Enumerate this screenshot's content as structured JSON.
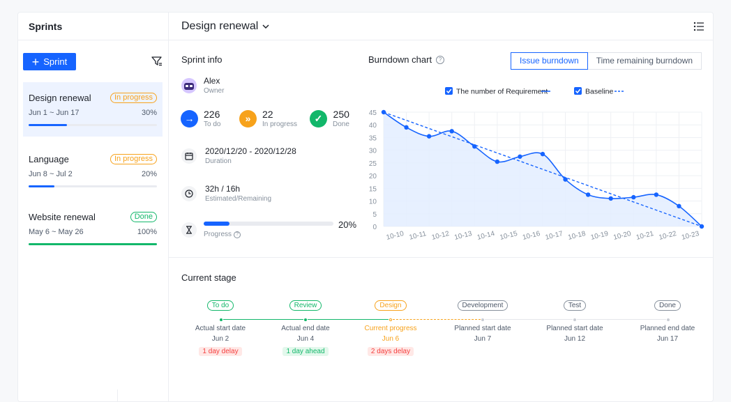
{
  "sidebar": {
    "title": "Sprints",
    "add_label": "Sprint",
    "items": [
      {
        "name": "Design renewal",
        "status": "In progress",
        "dates": "Jun 1 ~ Jun 17",
        "percent_label": "30%",
        "progress": 0.3
      },
      {
        "name": "Language",
        "status": "In progress",
        "dates": "Jun 8 ~ Jul 2",
        "percent_label": "20%",
        "progress": 0.2
      },
      {
        "name": "Website renewal",
        "status": "Done",
        "dates": "May 6 ~ May 26",
        "percent_label": "100%",
        "progress": 1.0
      }
    ]
  },
  "header": {
    "title": "Design renewal"
  },
  "info": {
    "title": "Sprint info",
    "owner_name": "Alex",
    "owner_label": "Owner",
    "stats": [
      {
        "value": "226",
        "label": "To do"
      },
      {
        "value": "22",
        "label": "In progress"
      },
      {
        "value": "250",
        "label": "Done"
      }
    ],
    "duration_value": "2020/12/20 - 2020/12/28",
    "duration_label": "Duration",
    "estimate_value": "32h / 16h",
    "estimate_label": "Estimated/Remaining",
    "progress_label": "Progress",
    "progress_pct": "20%",
    "progress": 0.2
  },
  "burndown": {
    "title": "Burndown chart",
    "tab_issue": "Issue burndown",
    "tab_time": "Time remaining burndown"
  },
  "chart_data": {
    "type": "line",
    "categories": [
      "10-10",
      "10-11",
      "10-12",
      "10-13",
      "10-14",
      "10-15",
      "10-16",
      "10-17",
      "10-18",
      "10-19",
      "10-20",
      "10-21",
      "10-22",
      "10-23"
    ],
    "series": [
      {
        "name": "The number of Requirement",
        "values": [
          45,
          39,
          35.5,
          37.5,
          31.5,
          25.5,
          27.5,
          28.5,
          18.5,
          12.5,
          11,
          11.5,
          12.5,
          8,
          0
        ]
      },
      {
        "name": "Baseline",
        "values": [
          45,
          0
        ]
      }
    ],
    "yticks": [
      "45",
      "40",
      "35",
      "30",
      "25",
      "20",
      "15",
      "10",
      "5",
      "0"
    ],
    "ylim": [
      0,
      45
    ],
    "grid": true,
    "legend": "top-center",
    "colors": {
      "line": "#1664ff",
      "area": "#e3edff"
    }
  },
  "stage": {
    "title": "Current stage",
    "items": [
      {
        "tag": "To do",
        "label": "Actual start date",
        "date": "Jun 2",
        "delay": "1 day delay",
        "color": "#12b76a",
        "delay_type": "red"
      },
      {
        "tag": "Review",
        "label": "Actual end date",
        "date": "Jun 4",
        "delay": "1 day ahead",
        "color": "#12b76a",
        "delay_type": "green"
      },
      {
        "tag": "Design",
        "label": "Current progress",
        "date": "Jun 6",
        "delay": "2 days delay",
        "color": "#f7a21b",
        "delay_type": "red"
      },
      {
        "tag": "Development",
        "label": "Planned start date",
        "date": "Jun 7",
        "delay": "",
        "color": "#86909c",
        "delay_type": ""
      },
      {
        "tag": "Test",
        "label": "Planned start date",
        "date": "Jun 12",
        "delay": "",
        "color": "#86909c",
        "delay_type": ""
      },
      {
        "tag": "Done",
        "label": "Planned end date",
        "date": "Jun 17",
        "delay": "",
        "color": "#86909c",
        "delay_type": ""
      }
    ]
  },
  "colors": {
    "accent": "#1664ff",
    "orange": "#f7a21b",
    "green": "#12b76a"
  }
}
